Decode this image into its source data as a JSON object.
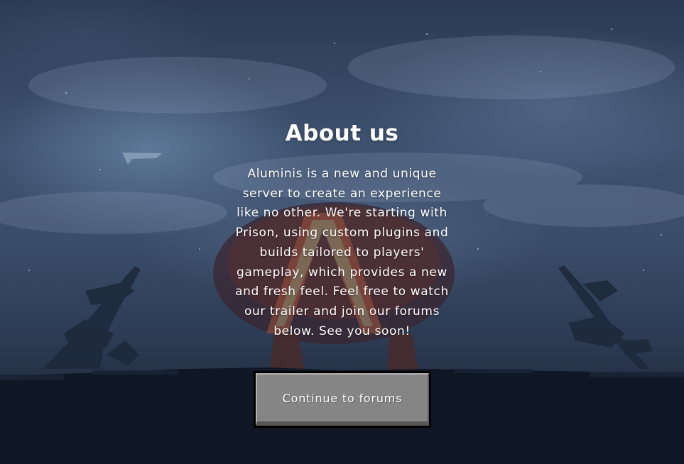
{
  "about": {
    "heading": "About us",
    "body": "Aluminis is a new and unique server to create an experience like no other. We're starting with Prison, using custom plugins and builds tailored to players' gameplay, which provides a new and fresh feel. Feel free to watch our trailer and join our forums below. See you soon!"
  },
  "cta": {
    "label": "Continue to forums"
  },
  "colors": {
    "sky_top": "#2b3a52",
    "sky_mid": "#3e5270",
    "ground": "#121a28",
    "button_face": "#858585",
    "button_border": "#000000",
    "text": "#ffffff"
  }
}
